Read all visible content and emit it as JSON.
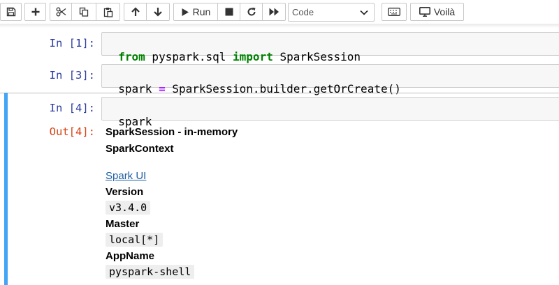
{
  "toolbar": {
    "run_label": "Run",
    "cell_type": "Code",
    "voila_label": "Voilà",
    "icons": [
      "save-icon",
      "plus-icon",
      "cut-icon",
      "copy-icon",
      "paste-icon",
      "arrow-up-icon",
      "arrow-down-icon",
      "run-icon",
      "stop-icon",
      "restart-icon",
      "fast-forward-icon",
      "keyboard-icon",
      "monitor-icon"
    ]
  },
  "cells": [
    {
      "prompt": "In [1]:",
      "code": [
        {
          "text": "from",
          "cls": "kw"
        },
        {
          "text": " pyspark.sql ",
          "cls": ""
        },
        {
          "text": "import",
          "cls": "kw"
        },
        {
          "text": " SparkSession",
          "cls": ""
        }
      ]
    },
    {
      "prompt": "In [3]:",
      "code": [
        {
          "text": "spark ",
          "cls": ""
        },
        {
          "text": "=",
          "cls": "op"
        },
        {
          "text": " SparkSession.builder.getOrCreate()",
          "cls": ""
        }
      ]
    },
    {
      "prompt": "In [4]:",
      "code": [
        {
          "text": "spark",
          "cls": ""
        }
      ]
    }
  ],
  "output": {
    "prompt": "Out[4]:",
    "session_title": "SparkSession - in-memory",
    "context_title": "SparkContext",
    "spark_ui_link": "Spark UI",
    "version_label": "Version",
    "version_value": "v3.4.0",
    "master_label": "Master",
    "master_value": "local[*]",
    "appname_label": "AppName",
    "appname_value": "pyspark-shell"
  },
  "colors": {
    "in_prompt": "#303f9f",
    "out_prompt": "#d84315",
    "keyword": "#008000",
    "operator": "#aa22ff",
    "selection_bar": "#42a5f5",
    "link": "#1f5fa3"
  }
}
